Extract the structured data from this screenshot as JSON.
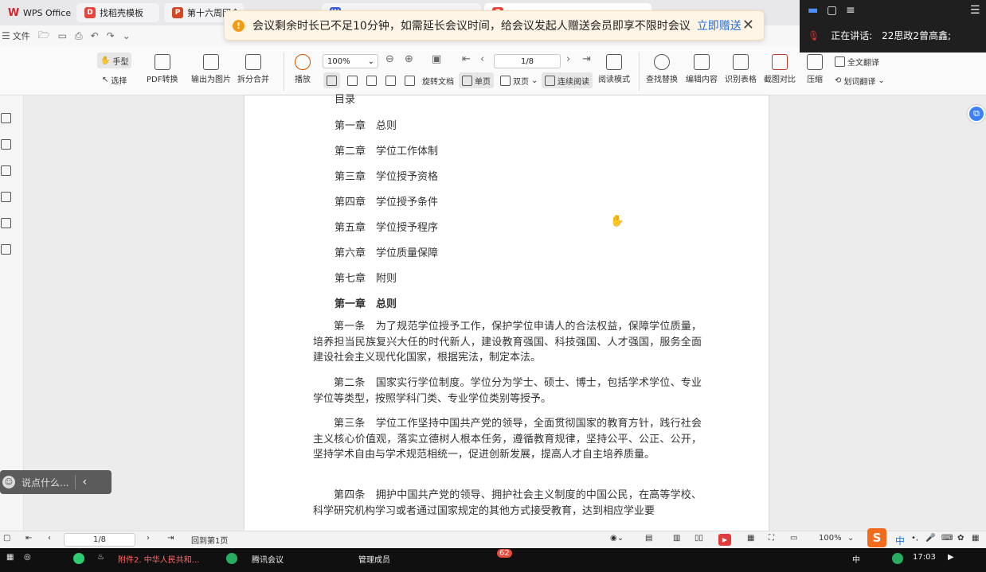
{
  "tabs": [
    {
      "label": "WPS Office",
      "icon": "wps-logo-icon"
    },
    {
      "label": "找稻壳模板",
      "icon": "docer-icon"
    },
    {
      "label": "第十六周团会",
      "icon": "ppt-icon"
    },
    {
      "label": "",
      "icon": "doc-icon"
    },
    {
      "label": "",
      "icon": "pdf-icon"
    }
  ],
  "menu": {
    "file_label": "文件"
  },
  "ribbon": {
    "hand_tool": "手型",
    "select_tool": "选择",
    "pdf_convert": "PDF转换",
    "export_image": "输出为图片",
    "split_merge": "拆分合并",
    "play": "播放",
    "zoom_value": "100%",
    "rotate_doc": "旋转文档",
    "single_page": "单页",
    "double_page": "双页",
    "continuous_read": "连续阅读",
    "read_mode": "阅读模式",
    "page_value": "1/8",
    "find_replace": "查找替换",
    "edit_content": "编辑内容",
    "recognize_table": "识别表格",
    "screenshot_compare": "截图对比",
    "compress": "压缩",
    "full_translate": "全文翻译",
    "word_translate": "划词翻译"
  },
  "notice": {
    "message": "会议剩余时长已不足10分钟，如需延长会议时间，给会议发起人赠送会员即享不限时会议",
    "action": "立即赠送"
  },
  "speaker": {
    "label": "正在讲话:",
    "name": "22思政2曾高鑫;"
  },
  "document": {
    "toc_title": "目录",
    "toc": [
      "第一章　总则",
      "第二章　学位工作体制",
      "第三章　学位授予资格",
      "第四章　学位授予条件",
      "第五章　学位授予程序",
      "第六章　学位质量保障",
      "第七章　附则"
    ],
    "chapter_heading": "第一章　总则",
    "paragraphs": [
      "第一条　为了规范学位授予工作，保护学位申请人的合法权益，保障学位质量，培养担当民族复兴大任的时代新人，建设教育强国、科技强国、人才强国，服务全面建设社会主义现代化国家，根据宪法，制定本法。",
      "第二条　国家实行学位制度。学位分为学士、硕士、博士，包括学术学位、专业学位等类型，按照学科门类、专业学位类别等授予。",
      "第三条　学位工作坚持中国共产党的领导，全面贯彻国家的教育方针，践行社会主义核心价值观，落实立德树人根本任务，遵循教育规律，坚持公平、公正、公开，坚持学术自由与学术规范相统一，促进创新发展，提高人才自主培养质量。",
      "第四条　拥护中国共产党的领导、拥护社会主义制度的中国公民，在高等学校、科学研究机构学习或者通过国家规定的其他方式接受教育，达到相应学业要"
    ]
  },
  "chat": {
    "placeholder": "说点什么..."
  },
  "status": {
    "page_value": "1/8",
    "back_to_first": "回到第1页",
    "zoom_value": "100%"
  },
  "ime": {
    "logo": "S",
    "lang": "中"
  },
  "taskbar": {
    "item1": "附件2. 中华人民共和...",
    "item2": "腾讯会议",
    "item3": "管理成员",
    "badge": "62",
    "tray_lang": "中",
    "clock": "17:03"
  }
}
